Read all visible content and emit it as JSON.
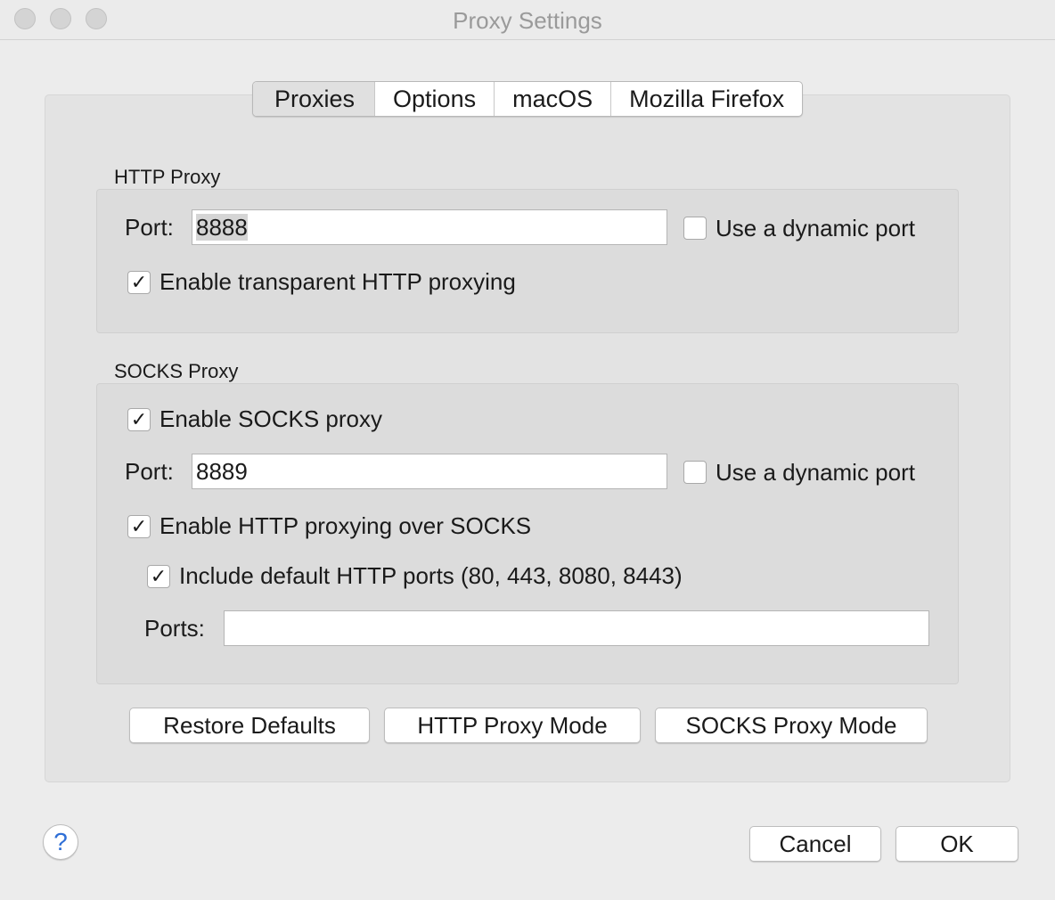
{
  "window": {
    "title": "Proxy Settings"
  },
  "tabs": [
    {
      "label": "Proxies",
      "selected": true
    },
    {
      "label": "Options",
      "selected": false
    },
    {
      "label": "macOS",
      "selected": false
    },
    {
      "label": "Mozilla Firefox",
      "selected": false
    }
  ],
  "http_proxy": {
    "title": "HTTP Proxy",
    "port_label": "Port:",
    "port_value": "8888",
    "dynamic_port_label": "Use a dynamic port",
    "dynamic_port_checked": false,
    "transparent_label": "Enable transparent HTTP proxying",
    "transparent_checked": true
  },
  "socks_proxy": {
    "title": "SOCKS Proxy",
    "enable_label": "Enable SOCKS proxy",
    "enable_checked": true,
    "port_label": "Port:",
    "port_value": "8889",
    "dynamic_port_label": "Use a dynamic port",
    "dynamic_port_checked": false,
    "http_over_socks_label": "Enable HTTP proxying over SOCKS",
    "http_over_socks_checked": true,
    "include_default_label": "Include default HTTP ports (80, 443, 8080, 8443)",
    "include_default_checked": true,
    "ports_label": "Ports:",
    "ports_value": ""
  },
  "actions": {
    "restore_defaults": "Restore Defaults",
    "http_proxy_mode": "HTTP Proxy Mode",
    "socks_proxy_mode": "SOCKS Proxy Mode"
  },
  "footer": {
    "help_icon": "?",
    "cancel": "Cancel",
    "ok": "OK"
  },
  "colors": {
    "window_bg": "#ececec",
    "help_accent": "#2f6fd6"
  },
  "checkmark": "✓"
}
